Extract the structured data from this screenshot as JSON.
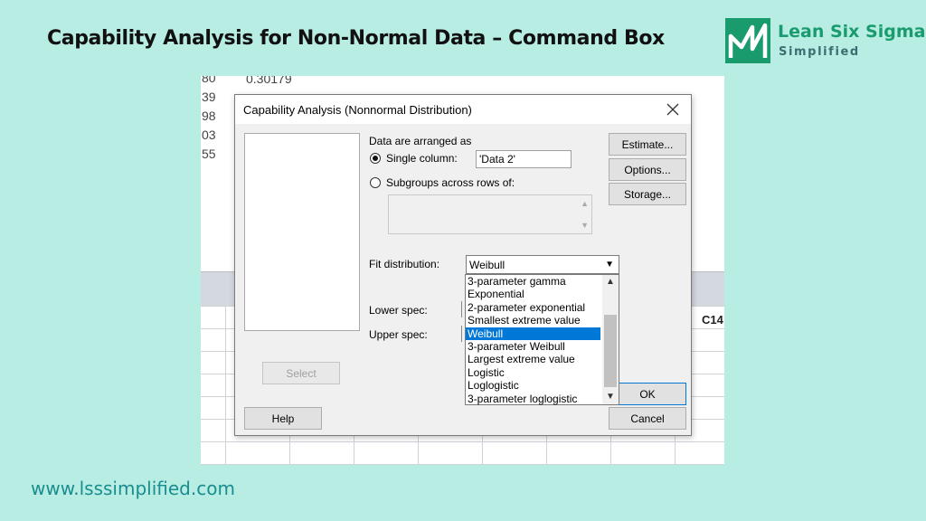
{
  "slide": {
    "title": "Capability Analysis for Non-Normal Data – Command Box",
    "website": "www.lsssimplified.com"
  },
  "logo": {
    "name": "Lean Six Sigma",
    "sub": "Simplified",
    "color": "#1a9b6e"
  },
  "worksheet": {
    "row_fragments": [
      "80",
      "39",
      "98",
      "03",
      "55"
    ],
    "first_value": "0.30179",
    "column_header": "C14"
  },
  "dialog": {
    "title": "Capability Analysis (Nonnormal Distribution)",
    "close_icon": "close-icon",
    "data_arranged_label": "Data are arranged as",
    "single_column_label": "Single column:",
    "single_column_value": "'Data 2'",
    "single_column_selected": true,
    "subgroups_label": "Subgroups across rows of:",
    "fit_distribution_label": "Fit distribution:",
    "fit_distribution_value": "Weibull",
    "lower_spec_label": "Lower spec:",
    "upper_spec_label": "Upper spec:",
    "distribution_options": [
      "3-parameter gamma",
      "Exponential",
      "2-parameter exponential",
      "Smallest extreme value",
      "Weibull",
      "3-parameter Weibull",
      "Largest extreme value",
      "Logistic",
      "Loglogistic",
      "3-parameter loglogistic"
    ],
    "selected_option_index": 4,
    "buttons": {
      "estimate": "Estimate...",
      "options": "Options...",
      "storage": "Storage...",
      "select": "Select",
      "help": "Help",
      "ok": "OK",
      "cancel": "Cancel"
    },
    "accent_color": "#0078d7"
  }
}
